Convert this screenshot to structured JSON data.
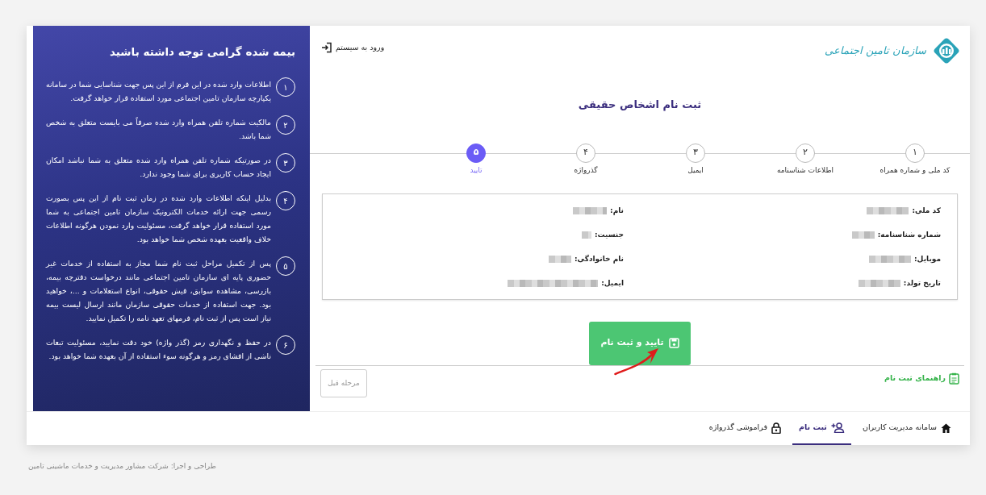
{
  "header": {
    "logo_text": "سازمان تامین اجتماعی",
    "login_link": "ورود به سیستم"
  },
  "notice": {
    "title": "بیمه شده گرامی توجه داشته باشید",
    "items": [
      {
        "number": "۱",
        "text": "اطلاعات وارد شده در این فرم از این پس جهت شناسایی شما در سامانه یکپارچه سازمان تامین اجتماعی مورد استفاده قرار خواهد گرفت."
      },
      {
        "number": "۲",
        "text": "مالکیت شماره تلفن همراه وارد شده صرفاً می بایست متعلق به شخص شما باشد."
      },
      {
        "number": "۳",
        "text": "در صورتیکه شماره تلفن همراه وارد شده متعلق به شما نباشد امکان ایجاد حساب کاربری برای شما وجود ندارد."
      },
      {
        "number": "۴",
        "text": "بدلیل اینکه اطلاعات وارد شده در زمان ثبت نام از این پس بصورت رسمی جهت ارائه خدمات الکترونیک سازمان تامین اجتماعی به شما مورد استفاده قرار خواهد گرفت، مسئولیت وارد نمودن هرگونه اطلاعات خلاف واقعیت بعهده شخص شما خواهد بود."
      },
      {
        "number": "۵",
        "text": "پس از تکمیل مراحل ثبت نام شما مجاز به استفاده از خدمات غیر حضوری پایه ای سازمان تامین اجتماعی مانند درخواست دفترچه بیمه، بازرسی، مشاهده سوابق، فیش حقوقی، انواع استعلامات و ...، خواهید بود. جهت استفاده از خدمات حقوقی سازمان مانند ارسال لیست بیمه نیاز است پس از ثبت نام، فرمهای تعهد نامه را تکمیل نمایید."
      },
      {
        "number": "۶",
        "text": "در حفظ و نگهداری رمز (گذر واژه) خود دقت نمایید، مسئولیت تبعات ناشی از افشای رمز و هرگونه سوء استفاده از آن بعهده شما خواهد بود."
      }
    ]
  },
  "title": "ثبت نام اشخاص حقیقی",
  "steps": [
    {
      "number": "۱",
      "label": "کد ملی و شماره همراه",
      "selected": false
    },
    {
      "number": "۲",
      "label": "اطلاعات شناسنامه",
      "selected": false
    },
    {
      "number": "۳",
      "label": "ایمیل",
      "selected": false
    },
    {
      "number": "۴",
      "label": "گذرواژه",
      "selected": false
    },
    {
      "number": "۵",
      "label": "تایید",
      "selected": true
    }
  ],
  "summary": {
    "fields": [
      {
        "label": "کد ملی:",
        "redacted": true
      },
      {
        "label": "نام:",
        "redacted": true
      },
      {
        "label": "شماره شناسنامه:",
        "redacted": true
      },
      {
        "label": "جنسیت:",
        "redacted": true
      },
      {
        "label": "موبایل:",
        "redacted": true
      },
      {
        "label": "نام خانوادگی:",
        "redacted": true
      },
      {
        "label": "تاریخ تولد:",
        "redacted": true
      },
      {
        "label": "ایمیل:",
        "redacted": true
      }
    ]
  },
  "submit_button": "تایید و ثبت نام",
  "guide_link": "راهنمای ثبت نام",
  "back_button": {
    "label": "مرحله قبل",
    "disabled": true
  },
  "bottom_nav": [
    {
      "kind": "home",
      "label": "سامانه مدیریت کاربران",
      "selected": false
    },
    {
      "kind": "register",
      "label": "ثبت نام",
      "selected": true
    },
    {
      "kind": "password",
      "label": "فراموشی گذرواژه",
      "selected": false
    }
  ],
  "footer": "طراحی و اجرا: شرکت مشاور مدیریت و خدمات ماشینی تامین"
}
